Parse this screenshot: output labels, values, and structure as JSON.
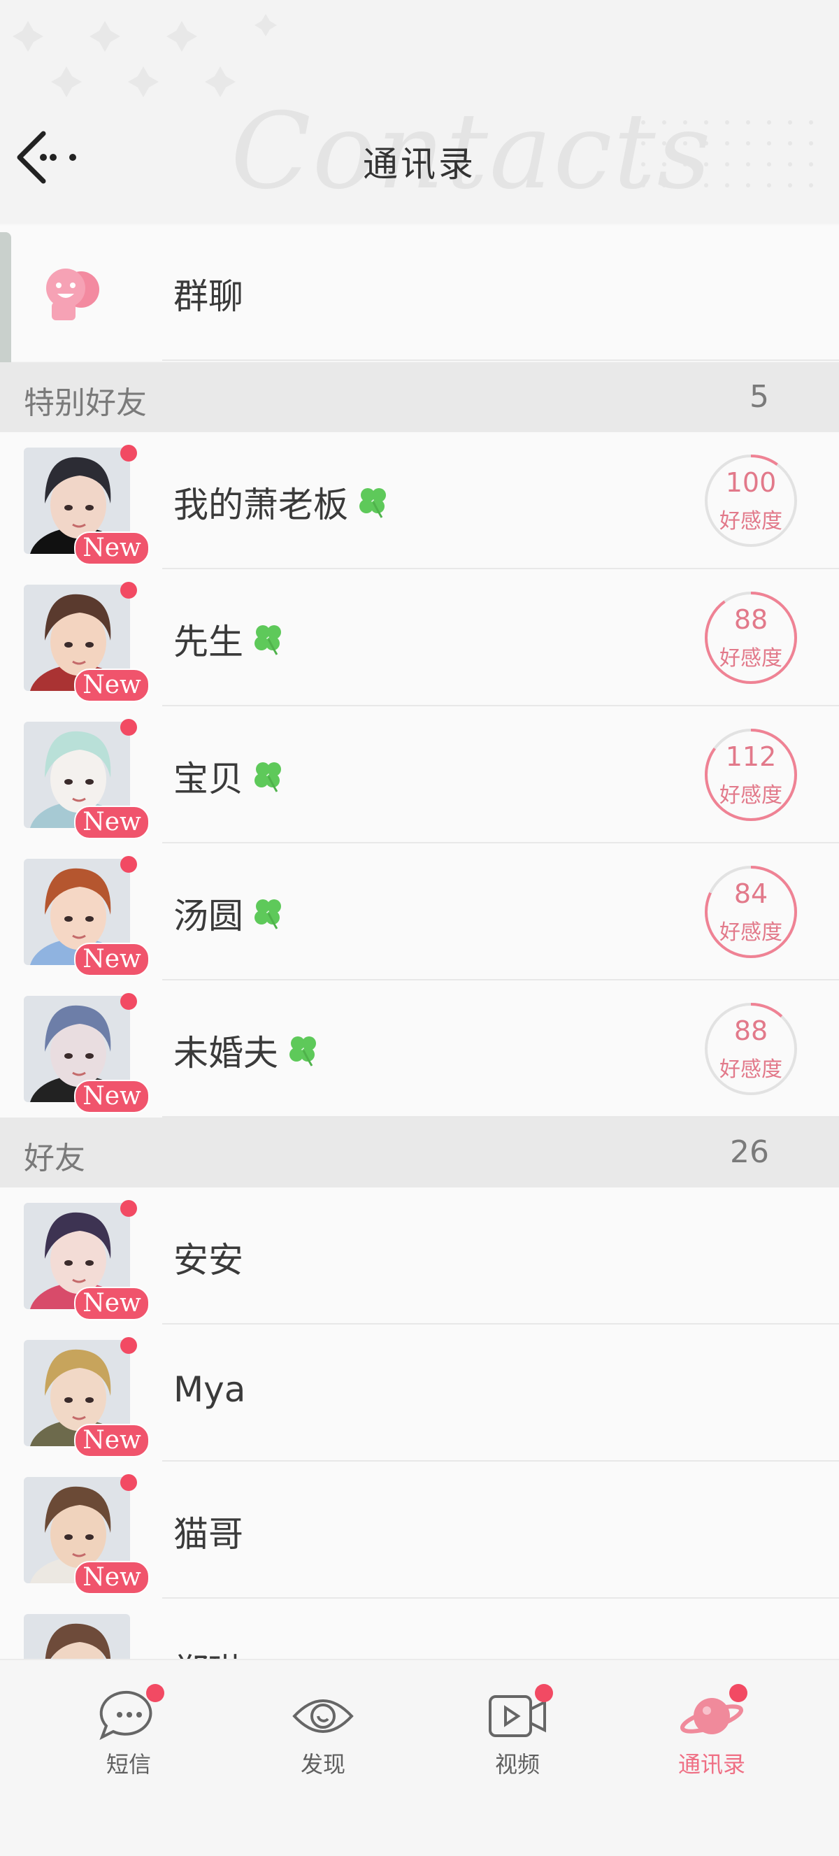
{
  "header": {
    "title": "通讯录",
    "watermark": "Contacts"
  },
  "group_chat": {
    "label": "群聊"
  },
  "special_friends": {
    "title": "特别好友",
    "count": "5",
    "items": [
      {
        "name": "我的萧老板",
        "badge": "New",
        "favor": "100",
        "favor_label": "好感度",
        "favor_fraction": 0.1
      },
      {
        "name": "先生",
        "badge": "New",
        "favor": "88",
        "favor_label": "好感度",
        "favor_fraction": 0.9
      },
      {
        "name": "宝贝",
        "badge": "New",
        "favor": "112",
        "favor_label": "好感度",
        "favor_fraction": 0.85
      },
      {
        "name": "汤圆",
        "badge": "New",
        "favor": "84",
        "favor_label": "好感度",
        "favor_fraction": 0.82
      },
      {
        "name": "未婚夫",
        "badge": "New",
        "favor": "88",
        "favor_label": "好感度",
        "favor_fraction": 0.12
      }
    ]
  },
  "friends": {
    "title": "好友",
    "count": "26",
    "items": [
      {
        "name": "安安",
        "badge": "New"
      },
      {
        "name": "Mya",
        "badge": "New"
      },
      {
        "name": "猫哥",
        "badge": "New"
      },
      {
        "name": "郑琳",
        "badge": ""
      }
    ]
  },
  "nav": {
    "items": [
      {
        "label": "短信",
        "icon": "message-icon"
      },
      {
        "label": "发现",
        "icon": "eye-icon"
      },
      {
        "label": "视频",
        "icon": "video-icon"
      },
      {
        "label": "通讯录",
        "icon": "planet-icon"
      }
    ]
  },
  "colors": {
    "accent": "#f0546c",
    "favor_ring": "#ef8294",
    "clover": "#5ec95a",
    "active_nav": "#ef6f84"
  }
}
